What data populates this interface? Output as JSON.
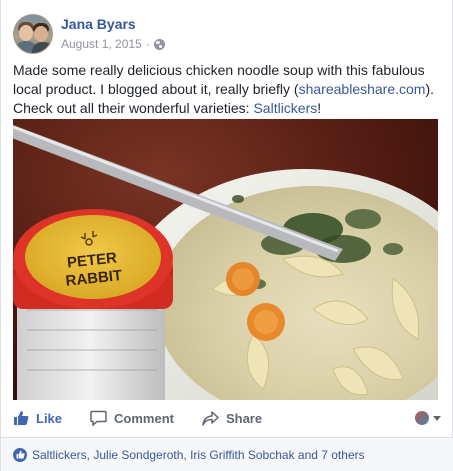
{
  "post": {
    "author": "Jana Byars",
    "date": "August 1, 2015",
    "separator": "·",
    "privacy_icon": "globe-icon",
    "text_part1": "Made some really delicious chicken noodle soup with this fabulous local product. I blogged about it, really briefly (",
    "link1": "shareableshare.com",
    "text_part2": "). Check out all their wonderful varieties: ",
    "link2": "Saltlickers",
    "text_part3": "!",
    "photo": {
      "jar_lid_brand": "PETER\nRABBIT",
      "accent_color": "#e5322d"
    }
  },
  "actions": {
    "like_label": "Like",
    "comment_label": "Comment",
    "share_label": "Share"
  },
  "likes_summary": "Saltlickers, Julie Sondgeroth, Iris Griffith Sobchak and 7 others",
  "colors": {
    "brand_blue": "#365899",
    "like_blue": "#4267b2",
    "muted": "#90949c"
  }
}
